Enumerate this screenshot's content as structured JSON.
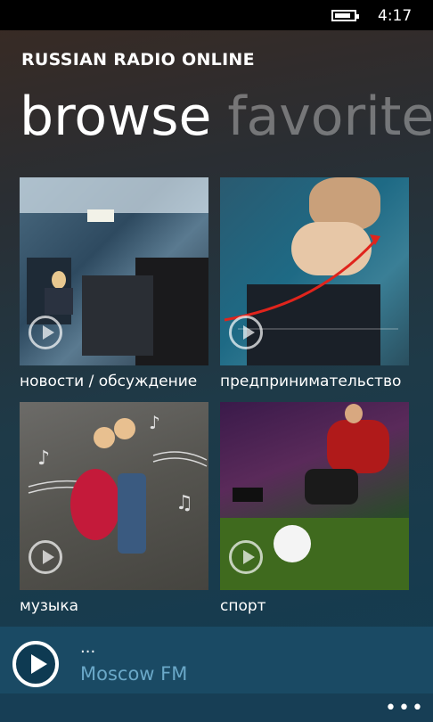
{
  "status_bar": {
    "time": "4:17",
    "battery_icon": "battery-icon"
  },
  "app_title": "RUSSIAN RADIO ONLINE",
  "pivot": {
    "active": "browse",
    "inactive": "favorite"
  },
  "tiles": [
    {
      "label": "новости / обсуждение"
    },
    {
      "label": "предпринимательство"
    },
    {
      "label": "музыка"
    },
    {
      "label": "спорт"
    }
  ],
  "now_playing": {
    "status": "...",
    "station": "Moscow FM"
  },
  "app_bar": {
    "more": "•••"
  }
}
